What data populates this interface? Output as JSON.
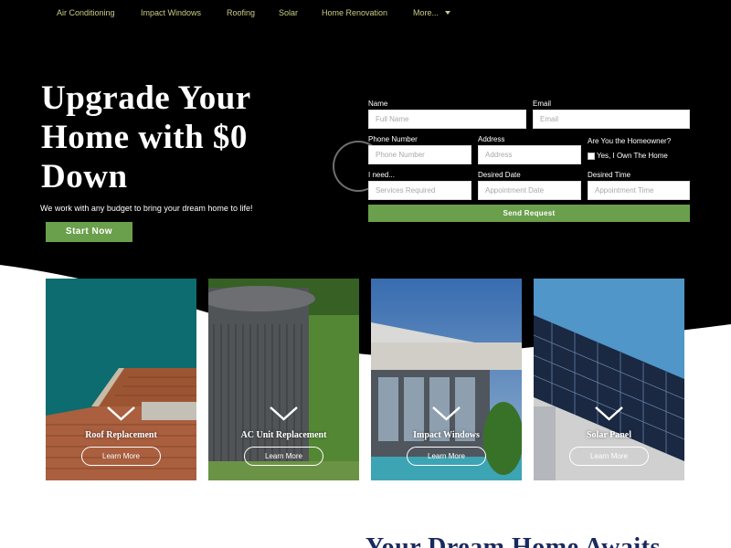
{
  "nav": {
    "items": [
      "Air Conditioning",
      "Impact Windows",
      "Roofing",
      "Solar",
      "Home Renovation",
      "More..."
    ]
  },
  "hero": {
    "headline": "Upgrade Your Home with $0 Down",
    "subline": "We work with any budget to bring your dream home to life!",
    "cta_label": "Start Now"
  },
  "form": {
    "name": {
      "label": "Name",
      "placeholder": "Full Name"
    },
    "email": {
      "label": "Email",
      "placeholder": "Email"
    },
    "phone": {
      "label": "Phone Number",
      "placeholder": "Phone Number"
    },
    "address": {
      "label": "Address",
      "placeholder": "Address"
    },
    "homeowner": {
      "label": "Are You the Homeowner?",
      "option": "Yes, I Own The Home"
    },
    "need": {
      "label": "I need...",
      "placeholder": "Services Required"
    },
    "date": {
      "label": "Desired Date",
      "placeholder": "Appointment Date"
    },
    "time": {
      "label": "Desired Time",
      "placeholder": "Appointment Time"
    },
    "submit_label": "Send Request"
  },
  "cards": [
    {
      "title": "Roof Replacement",
      "button": "Learn More",
      "icon": "roof-photo"
    },
    {
      "title": "AC Unit Replacement",
      "button": "Learn More",
      "icon": "ac-unit-photo"
    },
    {
      "title": "Impact Windows",
      "button": "Learn More",
      "icon": "modern-house-photo"
    },
    {
      "title": "Solar Panel",
      "button": "Learn More",
      "icon": "solar-panels-photo"
    }
  ],
  "section": {
    "heading": "Your Dream Home Awaits"
  },
  "colors": {
    "hero_bg": "#000000",
    "accent_green": "#6a9f4b",
    "nav_text": "#c8cd82",
    "heading_navy": "#1a2a5e"
  }
}
